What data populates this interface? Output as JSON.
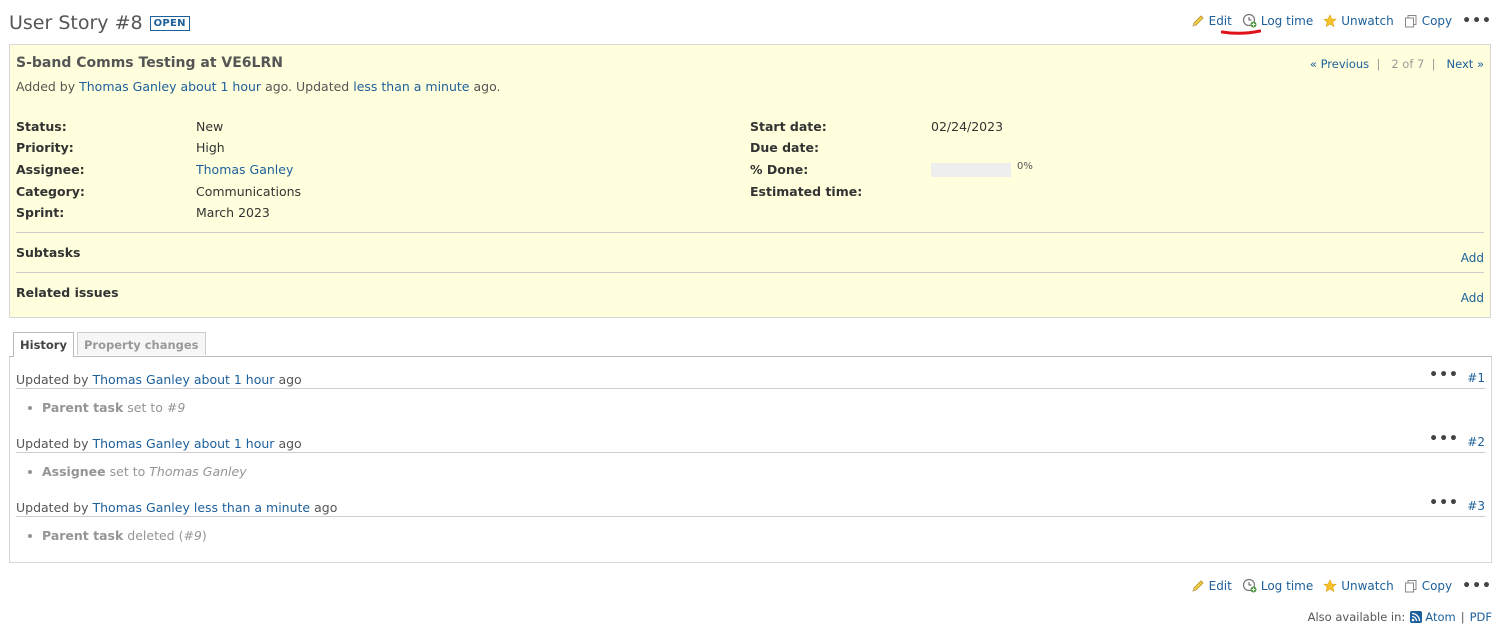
{
  "header": {
    "title": "User Story #8",
    "status_badge": "OPEN"
  },
  "actions": {
    "edit": "Edit",
    "log_time": "Log time",
    "unwatch": "Unwatch",
    "copy": "Copy",
    "more": "•••"
  },
  "issue": {
    "subject": "S-band Comms Testing at VE6LRN",
    "added_by_prefix": "Added by",
    "author": "Thomas Ganley",
    "added_ago": "about 1 hour",
    "updated_text": "ago. Updated",
    "updated_ago": "less than a minute",
    "ago": "ago.",
    "nav": {
      "previous": "« Previous",
      "position": "2 of 7",
      "next": "Next »"
    },
    "attributes_left": [
      {
        "label": "Status:",
        "value": "New"
      },
      {
        "label": "Priority:",
        "value": "High"
      },
      {
        "label": "Assignee:",
        "value": "Thomas Ganley"
      },
      {
        "label": "Category:",
        "value": "Communications"
      },
      {
        "label": "Sprint:",
        "value": "March 2023"
      }
    ],
    "attributes_right": [
      {
        "label": "Start date:",
        "value": "02/24/2023"
      },
      {
        "label": "Due date:",
        "value": ""
      },
      {
        "label": "% Done:",
        "value": "0%"
      },
      {
        "label": "Estimated time:",
        "value": ""
      }
    ],
    "done_ratio": 0,
    "subtasks": {
      "title": "Subtasks",
      "add": "Add"
    },
    "related": {
      "title": "Related issues",
      "add": "Add"
    }
  },
  "tabs": [
    {
      "label": "History",
      "selected": true
    },
    {
      "label": "Property changes",
      "selected": false
    }
  ],
  "journals": [
    {
      "prefix": "Updated by",
      "user": "Thomas Ganley",
      "when": "about 1 hour",
      "suffix": "ago",
      "number": "#1",
      "field": "Parent task",
      "change": "set to",
      "value": "#9"
    },
    {
      "prefix": "Updated by",
      "user": "Thomas Ganley",
      "when": "about 1 hour",
      "suffix": "ago",
      "number": "#2",
      "field": "Assignee",
      "change": "set to",
      "value": "Thomas Ganley"
    },
    {
      "prefix": "Updated by",
      "user": "Thomas Ganley",
      "when": "less than a minute",
      "suffix": "ago",
      "number": "#3",
      "field": "Parent task",
      "change": "deleted (",
      "value": "#9",
      "close": ")"
    }
  ],
  "footer": {
    "also_available": "Also available in:",
    "atom": "Atom",
    "separator": "|",
    "pdf": "PDF"
  },
  "colors": {
    "link": "#1d5f9a",
    "issue_bg": "#ffffdd",
    "annotation_underline": "#e0121b"
  }
}
